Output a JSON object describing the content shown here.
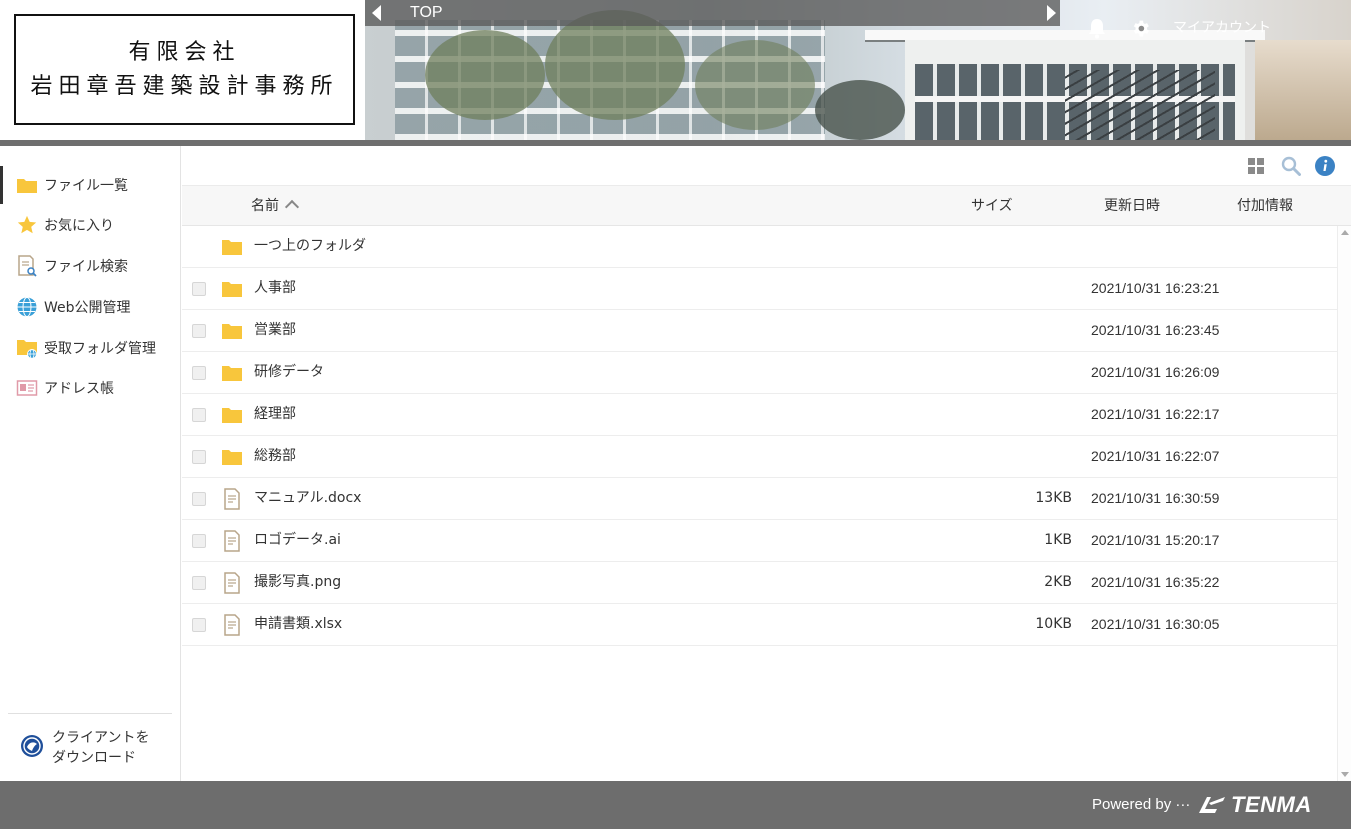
{
  "company": {
    "line1": "有限会社",
    "line2": "岩田章吾建築設計事務所"
  },
  "nav": {
    "current": "TOP"
  },
  "header": {
    "account_label": "マイアカウント"
  },
  "sidebar": {
    "items": [
      {
        "label": "ファイル一覧",
        "icon": "folder-icon"
      },
      {
        "label": "お気に入り",
        "icon": "star-icon"
      },
      {
        "label": "ファイル検索",
        "icon": "file-search-icon"
      },
      {
        "label": "Web公開管理",
        "icon": "globe-icon"
      },
      {
        "label": "受取フォルダ管理",
        "icon": "inbox-folder-icon"
      },
      {
        "label": "アドレス帳",
        "icon": "address-card-icon"
      }
    ],
    "download_line1": "クライアントを",
    "download_line2": "ダウンロード"
  },
  "table": {
    "headers": {
      "name": "名前",
      "size": "サイズ",
      "date": "更新日時",
      "extra": "付加情報"
    },
    "parent_folder": "一つ上のフォルダ",
    "rows": [
      {
        "name": "人事部",
        "type": "folder",
        "size": "",
        "date": "2021/10/31 16:23:21"
      },
      {
        "name": "営業部",
        "type": "folder",
        "size": "",
        "date": "2021/10/31 16:23:45"
      },
      {
        "name": "研修データ",
        "type": "folder",
        "size": "",
        "date": "2021/10/31 16:26:09"
      },
      {
        "name": "経理部",
        "type": "folder",
        "size": "",
        "date": "2021/10/31 16:22:17"
      },
      {
        "name": "総務部",
        "type": "folder",
        "size": "",
        "date": "2021/10/31 16:22:07"
      },
      {
        "name": "マニュアル.docx",
        "type": "file",
        "size": "13KB",
        "date": "2021/10/31 16:30:59"
      },
      {
        "name": "ロゴデータ.ai",
        "type": "file",
        "size": "1KB",
        "date": "2021/10/31 15:20:17"
      },
      {
        "name": "撮影写真.png",
        "type": "file",
        "size": "2KB",
        "date": "2021/10/31 16:35:22"
      },
      {
        "name": "申請書類.xlsx",
        "type": "file",
        "size": "10KB",
        "date": "2021/10/31 16:30:05"
      }
    ]
  },
  "footer": {
    "powered_by": "Powered by ···",
    "brand": "TENMA"
  },
  "colors": {
    "folder": "#f8c63c",
    "header_gray": "#6e6e6e",
    "info_blue": "#3b82c4",
    "file_icon": "#b8a58a"
  }
}
